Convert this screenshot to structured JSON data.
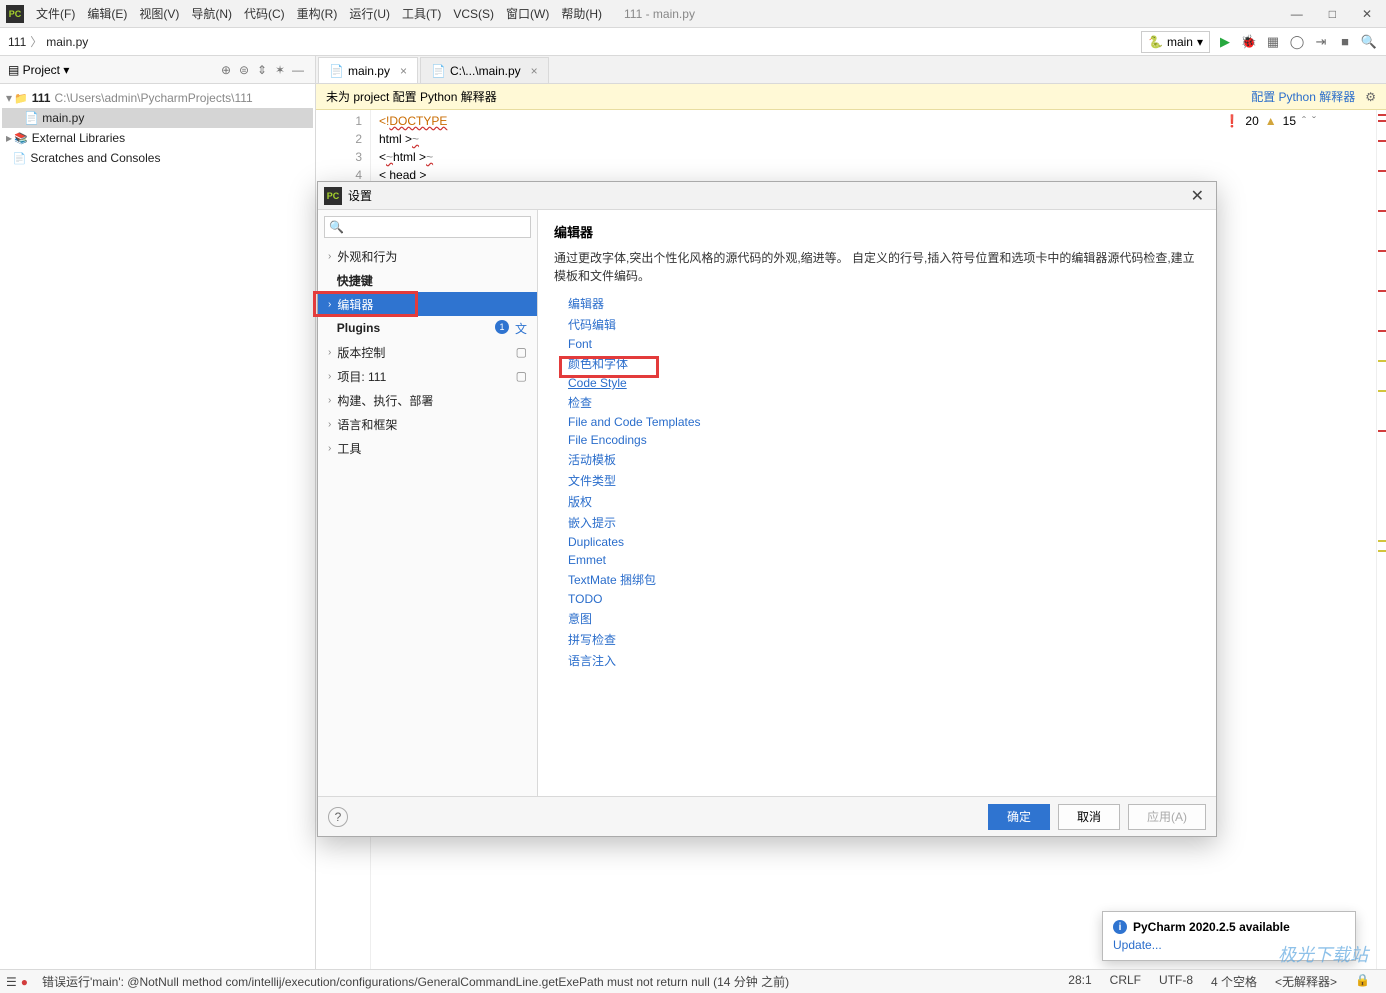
{
  "window": {
    "title": "111 - main.py"
  },
  "menus": [
    "文件(F)",
    "编辑(E)",
    "视图(V)",
    "导航(N)",
    "代码(C)",
    "重构(R)",
    "运行(U)",
    "工具(T)",
    "VCS(S)",
    "窗口(W)",
    "帮助(H)"
  ],
  "breadcrumbs": {
    "root": "111",
    "file": "main.py"
  },
  "runConfig": {
    "selected": "main"
  },
  "projectPane": {
    "title": "Project",
    "root": {
      "name": "111",
      "path": "C:\\Users\\admin\\PycharmProjects\\111"
    },
    "file": "main.py",
    "extLibs": "External Libraries",
    "scratches": "Scratches and Consoles"
  },
  "tabs": [
    {
      "label": "main.py",
      "active": true
    },
    {
      "label": "C:\\...\\main.py",
      "active": false
    }
  ],
  "interpreterBanner": {
    "msg": "未为 project 配置 Python 解释器",
    "action": "配置 Python 解释器"
  },
  "inspections": {
    "errors": "20",
    "warnings": "15"
  },
  "code": {
    "lines": [
      "1",
      "2",
      "3",
      "4"
    ],
    "l1a": "<!",
    "l1b": "DOCTYPE",
    "l2": "html >",
    "l3a": "<",
    "l3b": "html",
    "l3c": ">",
    "l4a": "< ",
    "l4b": "head",
    "l4c": " >"
  },
  "dialog": {
    "title": "设置",
    "searchPlaceholder": "",
    "categories": [
      {
        "label": "外观和行为",
        "expand": true
      },
      {
        "label": "快捷键",
        "bold": true
      },
      {
        "label": "编辑器",
        "expand": true,
        "selected": true
      },
      {
        "label": "Plugins",
        "bold": true,
        "badge": true
      },
      {
        "label": "版本控制",
        "expand": true,
        "proj": true
      },
      {
        "label": "项目: 111",
        "expand": true,
        "proj": true
      },
      {
        "label": "构建、执行、部署",
        "expand": true
      },
      {
        "label": "语言和框架",
        "expand": true
      },
      {
        "label": "工具",
        "expand": true
      }
    ],
    "right": {
      "heading": "编辑器",
      "desc": "通过更改字体,突出个性化风格的源代码的外观,缩进等。 自定义的行号,插入符号位置和选项卡中的编辑器源代码检查,建立模板和文件编码。",
      "links": [
        "编辑器",
        "代码编辑",
        "Font",
        "颜色和字体",
        "Code Style",
        "检查",
        "File and Code Templates",
        "File Encodings",
        "活动模板",
        "文件类型",
        "版权",
        "嵌入提示",
        "Duplicates",
        "Emmet",
        "TextMate 捆绑包",
        "TODO",
        "意图",
        "拼写检查",
        "语言注入"
      ],
      "highlightIndex": 4
    },
    "buttons": {
      "ok": "确定",
      "cancel": "取消",
      "apply": "应用(A)"
    }
  },
  "notification": {
    "title": "PyCharm 2020.2.5 available",
    "link": "Update..."
  },
  "status": {
    "left": "错误运行'main': @NotNull method com/intellij/execution/configurations/GeneralCommandLine.getExePath must not return null (14 分钟 之前)",
    "pos": "28:1",
    "eol": "CRLF",
    "enc": "UTF-8",
    "indent": "4 个空格",
    "interp": "<无解释器>"
  },
  "watermark": "极光下载站"
}
